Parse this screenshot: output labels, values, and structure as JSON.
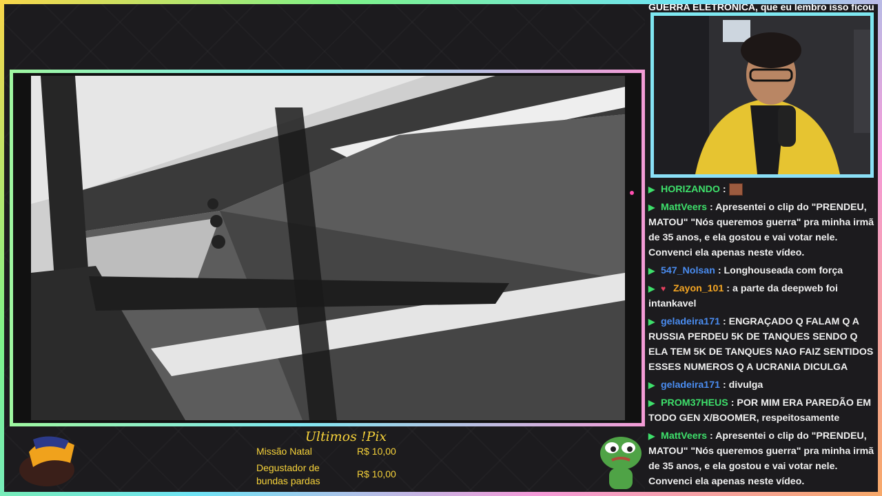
{
  "chat_top_text": "GUERRA ELETRÔNICA, que eu lembro isso ficou",
  "pix": {
    "title": "Ultimos !Pix",
    "entries": [
      {
        "name": "Missão Natal",
        "amount": "R$ 10,00"
      },
      {
        "name_line1": "Degustador de",
        "name_line2": "bundas pardas",
        "amount": "R$ 10,00"
      }
    ]
  },
  "chat": [
    {
      "user": "HORIZANDO",
      "text": ""
    },
    {
      "user": "MattVeers",
      "text": "Apresentei o clip do \"PRENDEU, MATOU\" \"Nós queremos guerra\" pra minha irmã de 35 anos, e ela gostou e vai votar nele. Convenci ela apenas neste vídeo."
    },
    {
      "user": "547_Nolsan",
      "text": "Longhouseada com força"
    },
    {
      "user": "Zayon_101",
      "text": "a parte da deepweb foi intankavel"
    },
    {
      "user": "geladeira171",
      "text": "ENGRAÇADO Q FALAM Q A RUSSIA PERDEU 5K DE TANQUES SENDO Q ELA TEM 5K DE TANQUES NAO FAIZ SENTIDOS ESSES NUMEROS Q A UCRANIA DICULGA"
    },
    {
      "user": "geladeira171",
      "text": "divulga"
    },
    {
      "user": "PROM37HEUS",
      "text": "POR MIM ERA PAREDÃO EM TODO GEN X/BOOMER, respeitosamente"
    },
    {
      "user": "MattVeers",
      "text": "Apresentei o clip do \"PRENDEU, MATOU\" \"Nós queremos guerra\" pra minha irmã de 35 anos, e ela gostou e vai votar nele. Convenci ela apenas neste vídeo."
    }
  ],
  "separator": ":"
}
